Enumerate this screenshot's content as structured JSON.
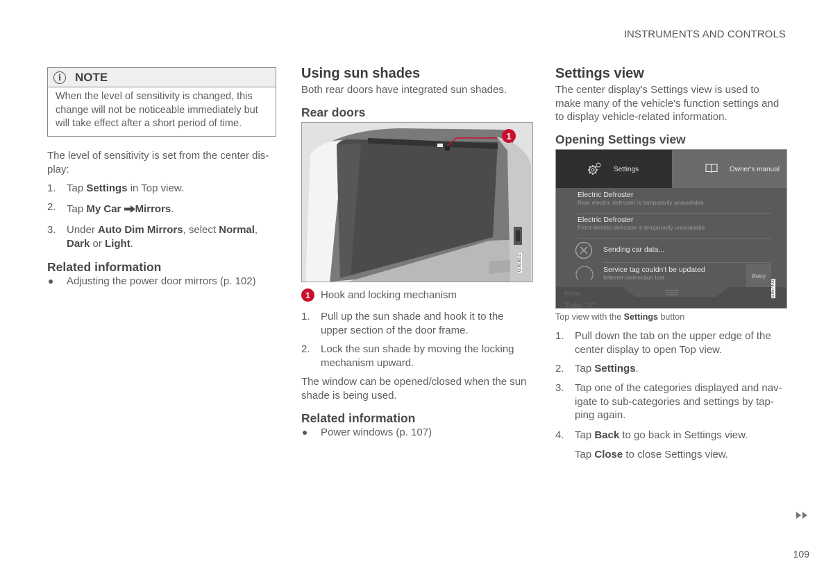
{
  "header": {
    "section": "INSTRUMENTS AND CONTROLS"
  },
  "column1": {
    "note": {
      "icon": "info-icon",
      "title": "NOTE",
      "body": "When the level of sensitivity is changed, this change will not be noticeable immediately but will take effect after a short period of time."
    },
    "intro_line1": "The level of sensitivity is set from the center dis-",
    "intro_line2": "play:",
    "steps": [
      {
        "num": "1.",
        "parts": [
          "Tap ",
          "Settings",
          " in Top view."
        ]
      },
      {
        "num": "2.",
        "parts": [
          "Tap ",
          "My Car",
          "Mirrors",
          "."
        ]
      },
      {
        "num": "3.",
        "parts": [
          "Under ",
          "Auto Dim Mirrors",
          ", select ",
          "Normal",
          ",",
          "Dark",
          " or ",
          "Light",
          "."
        ]
      }
    ],
    "related_heading": "Related information",
    "related": [
      "Adjusting the power door mirrors (p. 102)"
    ]
  },
  "column2": {
    "title": "Using sun shades",
    "intro": "Both rear doors have integrated sun shades.",
    "subheading": "Rear doors",
    "figure": {
      "code": "G063655",
      "callout": "1"
    },
    "legend": {
      "num": "1",
      "text": "Hook and locking mechanism"
    },
    "steps": [
      {
        "num": "1.",
        "line1": "Pull up the sun shade and hook it to the",
        "line2": "upper section of the door frame."
      },
      {
        "num": "2.",
        "line1": "Lock the sun shade by moving the locking",
        "line2": "mechanism upward."
      }
    ],
    "para_line1": "The window can be opened/closed when the sun",
    "para_line2": "shade is being used.",
    "related_heading": "Related information",
    "related": [
      "Power windows (p. 107)"
    ]
  },
  "column3": {
    "title": "Settings view",
    "intro_line1": "The center display's Settings view is used to",
    "intro_line2": "make many of the vehicle's function settings and",
    "intro_line3": "to display vehicle-related information.",
    "subheading": "Opening Settings view",
    "screen": {
      "tab_settings": "Settings",
      "tab_manual": "Owner's manual",
      "rows": [
        {
          "title": "Electric Defroster",
          "sub": "Rear electric defroster is temporarily unavailable"
        },
        {
          "title": "Electric Defroster",
          "sub": "Front electric defroster is temporarily unavailable"
        }
      ],
      "status1": "Sending car data...",
      "status2_title": "Service tag couldn't be updated",
      "status2_sub": "Internet connection lost",
      "retry": "Retry",
      "bottom_left": "Phone",
      "bottom_bg": "Tollis 2C",
      "code": "G057403"
    },
    "caption_pre": "Top view with the ",
    "caption_bold": "Settings",
    "caption_post": " button",
    "steps": [
      {
        "num": "1.",
        "line1": "Pull down the tab on the upper edge of the",
        "line2": "center display to open Top view."
      },
      {
        "num": "2.",
        "pre": "Tap ",
        "bold": "Settings",
        "post": "."
      },
      {
        "num": "3.",
        "line1": "Tap one of the categories displayed and nav-",
        "line2": "igate to sub-categories and settings by tap-",
        "line3": "ping again."
      },
      {
        "num": "4.",
        "pre": "Tap ",
        "bold": "Back",
        "post": " to go back in Settings view."
      }
    ],
    "close_pre": "Tap ",
    "close_bold": "Close",
    "close_post": " to close Settings view."
  },
  "footer": {
    "page_number": "109",
    "continue_icon": "double-arrow-right-icon"
  }
}
